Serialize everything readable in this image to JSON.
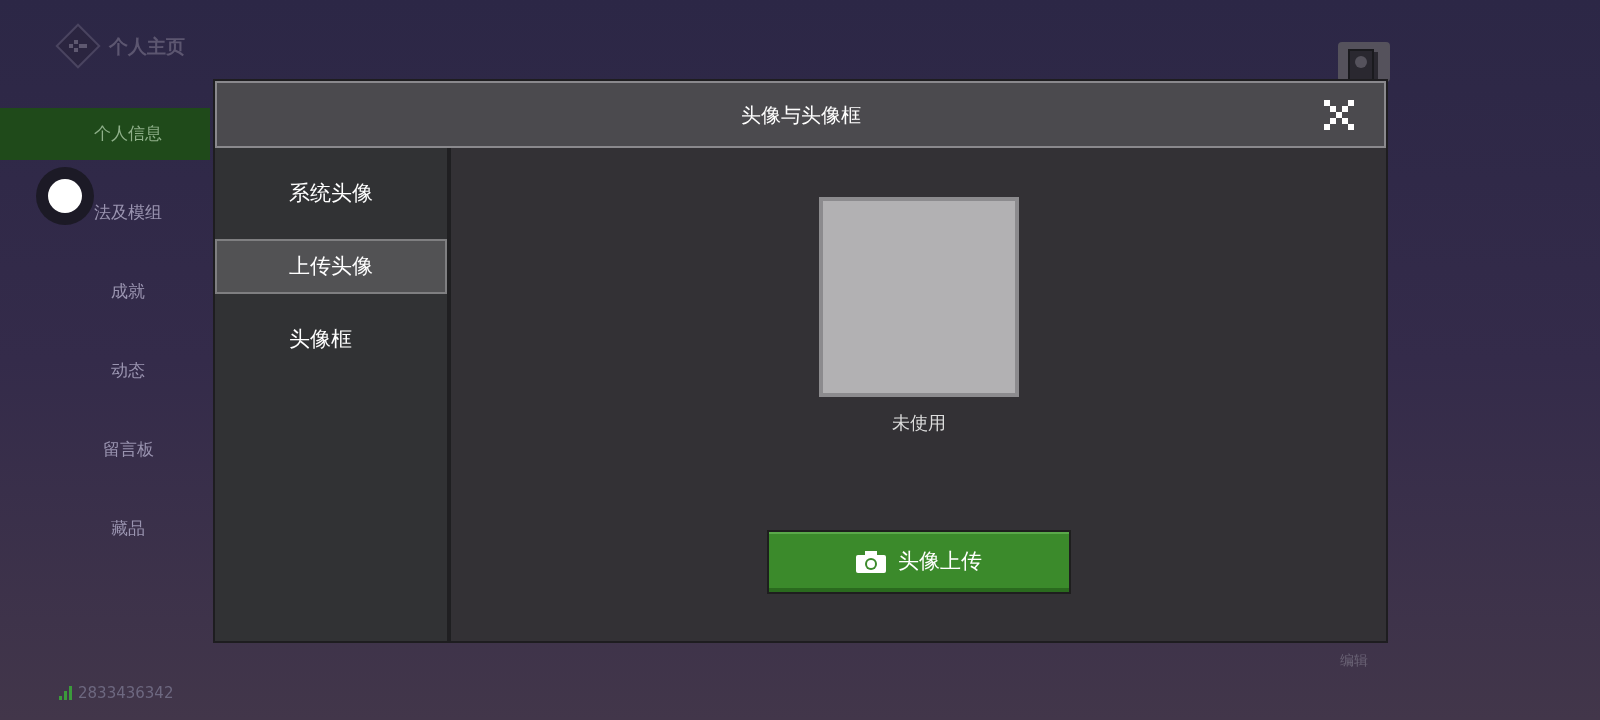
{
  "page": {
    "title": "个人主页"
  },
  "sidebar": {
    "items": [
      {
        "label": "个人信息",
        "selected": true
      },
      {
        "label": "法及模组",
        "selected": false
      },
      {
        "label": "成就",
        "selected": false
      },
      {
        "label": "动态",
        "selected": false
      },
      {
        "label": "留言板",
        "selected": false
      },
      {
        "label": "藏品",
        "selected": false
      }
    ]
  },
  "user_id": "2833436342",
  "edit_label": "编辑",
  "dialog": {
    "title": "头像与头像框",
    "tabs": [
      {
        "label": "系统头像",
        "selected": false
      },
      {
        "label": "上传头像",
        "selected": true
      },
      {
        "label": "头像框",
        "selected": false
      }
    ],
    "avatar_status": "未使用",
    "upload_button": "头像上传"
  }
}
